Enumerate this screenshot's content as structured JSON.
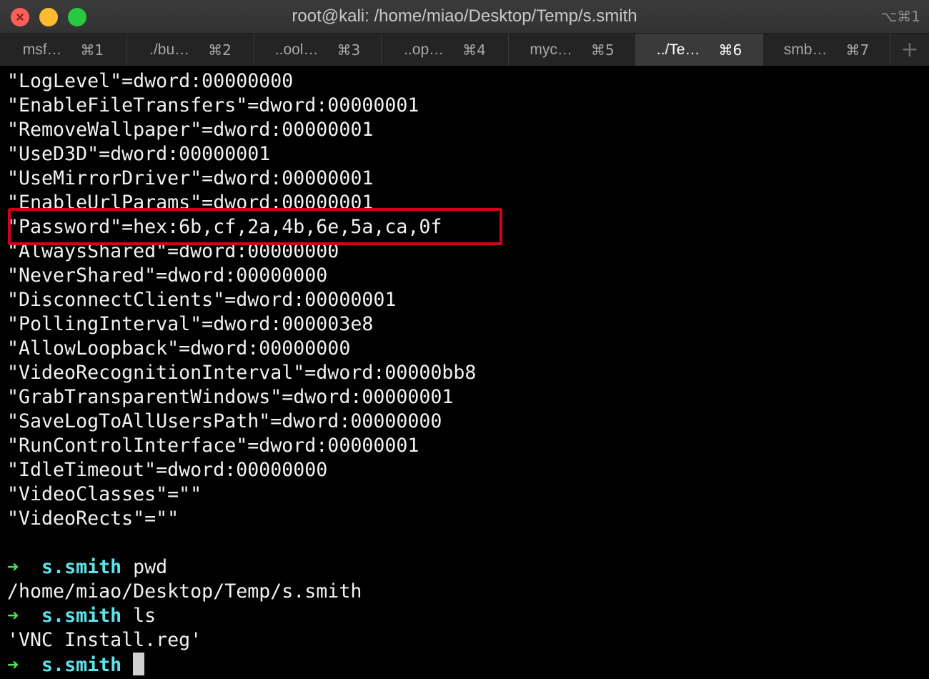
{
  "window": {
    "title": "root@kali: /home/miao/Desktop/Temp/s.smith",
    "shortcut": "⌥⌘1"
  },
  "tabs": [
    {
      "label": "msf…",
      "key": "⌘1",
      "active": false
    },
    {
      "label": "./bu…",
      "key": "⌘2",
      "active": false
    },
    {
      "label": "..ool…",
      "key": "⌘3",
      "active": false
    },
    {
      "label": "..op…",
      "key": "⌘4",
      "active": false
    },
    {
      "label": "myc…",
      "key": "⌘5",
      "active": false
    },
    {
      "label": "../Te…",
      "key": "⌘6",
      "active": true
    },
    {
      "label": "smb…",
      "key": "⌘7",
      "active": false
    }
  ],
  "new_tab_icon": "plus-icon",
  "output_lines": [
    "\"LogLevel\"=dword:00000000",
    "\"EnableFileTransfers\"=dword:00000001",
    "\"RemoveWallpaper\"=dword:00000001",
    "\"UseD3D\"=dword:00000001",
    "\"UseMirrorDriver\"=dword:00000001",
    "\"EnableUrlParams\"=dword:00000001",
    "\"Password\"=hex:6b,cf,2a,4b,6e,5a,ca,0f",
    "\"AlwaysShared\"=dword:00000000",
    "\"NeverShared\"=dword:00000000",
    "\"DisconnectClients\"=dword:00000001",
    "\"PollingInterval\"=dword:000003e8",
    "\"AllowLoopback\"=dword:00000000",
    "\"VideoRecognitionInterval\"=dword:00000bb8",
    "\"GrabTransparentWindows\"=dword:00000001",
    "\"SaveLogToAllUsersPath\"=dword:00000000",
    "\"RunControlInterface\"=dword:00000001",
    "\"IdleTimeout\"=dword:00000000",
    "\"VideoClasses\"=\"\"",
    "\"VideoRects\"=\"\""
  ],
  "highlighted_line_index": 6,
  "highlight_color": "#d0021b",
  "prompt": {
    "arrow": "➜",
    "dir": "s.smith"
  },
  "session": [
    {
      "type": "prompt",
      "command": "pwd"
    },
    {
      "type": "output",
      "text": "/home/miao/Desktop/Temp/s.smith"
    },
    {
      "type": "prompt",
      "command": "ls"
    },
    {
      "type": "output",
      "text": "'VNC Install.reg'"
    },
    {
      "type": "prompt",
      "command": "",
      "cursor": true
    }
  ],
  "colors": {
    "prompt_arrow": "#4be34b",
    "prompt_dir": "#5fe3ea",
    "text": "#f2f2f2"
  }
}
